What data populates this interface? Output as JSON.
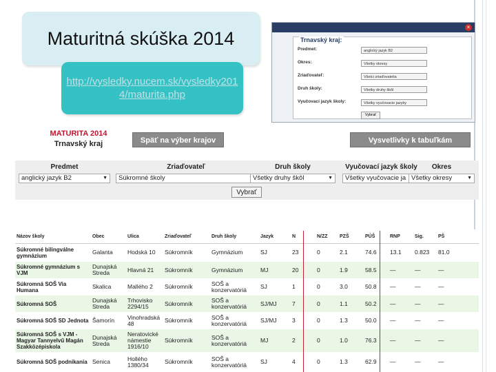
{
  "slide": {
    "title": "Maturitná skúška 2014",
    "link": "http://vysledky.nucem.sk/vysledky2014/maturita.php"
  },
  "filter_popup": {
    "legend": "Trnavský kraj:",
    "close": "×",
    "rows": [
      {
        "label": "Predmet:",
        "value": "anglický jazyk B2"
      },
      {
        "label": "Okres:",
        "value": "Všetky okresy"
      },
      {
        "label": "Zriaďovateľ:",
        "value": "Všetci zriaďovatelia"
      },
      {
        "label": "Druh školy:",
        "value": "Všetky druhy škôl"
      },
      {
        "label": "Vyučovací jazyk školy:",
        "value": "Všetky vyučovacie jazyky"
      }
    ],
    "button": "Vybrať"
  },
  "header": {
    "maturita": "MATURITA 2014",
    "region": "Trnavský kraj",
    "back_button": "Späť na výber krajov",
    "legend_button": "Vysvetlivky k tabuľkám"
  },
  "filters": [
    {
      "label": "Predmet",
      "value": "anglický jazyk B2"
    },
    {
      "label": "Zriaďovateľ",
      "value": "Súkromné školy"
    },
    {
      "label": "Druh školy",
      "value": "Všetky druhy škôl"
    },
    {
      "label": "Vyučovací jazyk školy",
      "value": "Všetky vyučovacie ja"
    },
    {
      "label": "Okres",
      "value": "Všetky okresy"
    }
  ],
  "submit": "Vybrať",
  "table": {
    "headers": [
      "Názov školy",
      "Obec",
      "Ulica",
      "Zriaďovateľ",
      "Druh školy",
      "Jazyk",
      "N",
      "N/ZZ",
      "PZŠ",
      "PÚŠ",
      "RNP",
      "Sig.",
      "PŠ"
    ],
    "rows": [
      [
        "Súkromné bilingválne gymnázium",
        "Galanta",
        "Hodská 10",
        "Súkromník",
        "Gymnázium",
        "SJ",
        "23",
        "0",
        "2.1",
        "74.6",
        "13.1",
        "0.823",
        "81.0"
      ],
      [
        "Súkromné gymnázium s VJM",
        "Dunajská Streda",
        "Hlavná 21",
        "Súkromník",
        "Gymnázium",
        "MJ",
        "20",
        "0",
        "1.9",
        "58.5",
        "—",
        "—",
        "—"
      ],
      [
        "Súkromná SOŠ Via Humana",
        "Skalica",
        "Mallého 2",
        "Súkromník",
        "SOŠ a konzervatóriá",
        "SJ",
        "1",
        "0",
        "3.0",
        "50.8",
        "—",
        "—",
        "—"
      ],
      [
        "Súkromná SOŠ",
        "Dunajská Streda",
        "Trhovisko 2294/15",
        "Súkromník",
        "SOŠ a konzervatóriá",
        "SJ/MJ",
        "7",
        "0",
        "1.1",
        "50.2",
        "—",
        "—",
        "—"
      ],
      [
        "Súkromná SOŠ SD Jednota",
        "Šamorín",
        "Vinohradská 48",
        "Súkromník",
        "SOŠ a konzervatóriá",
        "SJ/MJ",
        "3",
        "0",
        "1.3",
        "50.0",
        "—",
        "—",
        "—"
      ],
      [
        "Súkromná SOŠ s VJM - Magyar Tannyelvű Magán Szakközépiskola",
        "Dunajská Streda",
        "Neratovické námestie 1916/10",
        "Súkromník",
        "SOŠ a konzervatóriá",
        "MJ",
        "2",
        "0",
        "1.0",
        "76.3",
        "—",
        "—",
        "—"
      ],
      [
        "Súkromná SOŠ podnikania",
        "Senica",
        "Hollého 1380/34",
        "Súkromník",
        "SOŠ a konzervatóriá",
        "SJ",
        "4",
        "0",
        "1.3",
        "62.9",
        "—",
        "—",
        "—"
      ]
    ]
  }
}
